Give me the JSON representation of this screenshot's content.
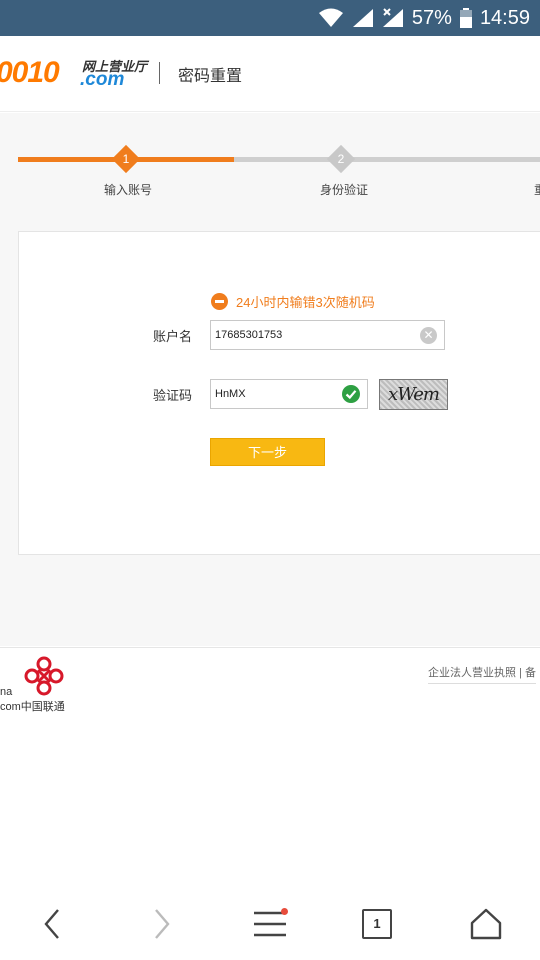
{
  "status_bar": {
    "battery": "57%",
    "time": "14:59",
    "icons": [
      "wifi-icon",
      "signal-icon",
      "signal-no-data-icon",
      "battery-icon"
    ]
  },
  "header": {
    "logo_number": "0010",
    "logo_subtitle": "网上营业厅",
    "logo_domain": ".com",
    "title": "密码重置"
  },
  "steps": [
    {
      "number": "1",
      "label": "输入账号"
    },
    {
      "number": "2",
      "label": "身份验证"
    },
    {
      "number": "",
      "label": "重"
    }
  ],
  "form": {
    "error_message": "24小时内输错3次随机码",
    "account_label": "账户名",
    "account_value": "17685301753",
    "captcha_label": "验证码",
    "captcha_value": "HnMX",
    "captcha_image_text": "xWem",
    "next_button": "下一步"
  },
  "footer": {
    "logo_text_line1": "na",
    "logo_text_line2": "com中国联通",
    "links": "企业法人营业执照  |  备"
  },
  "browser_nav": {
    "tabs_count": "1",
    "icons": [
      "back-icon",
      "forward-icon",
      "menu-icon",
      "tabs-icon",
      "home-icon"
    ]
  },
  "colors": {
    "status_bar": "#3c5f7d",
    "accent": "#f07d1d",
    "button": "#f8b812",
    "success": "#2ea043",
    "link_blue": "#1e88d8"
  }
}
